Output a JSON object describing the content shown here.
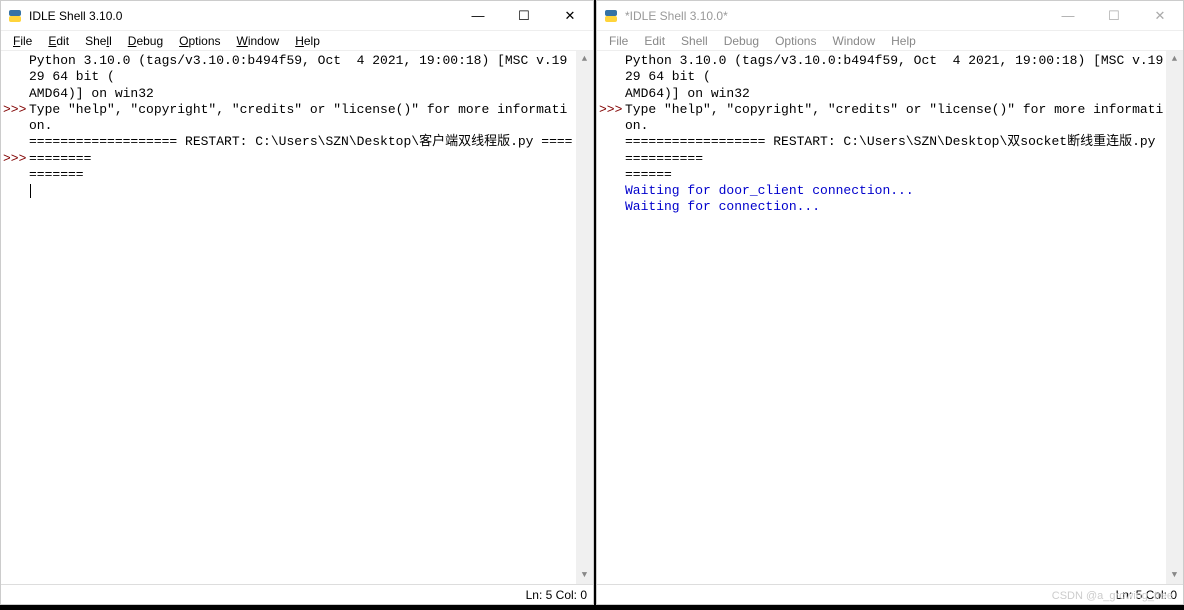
{
  "left": {
    "title": "IDLE Shell 3.10.0",
    "menus": [
      "File",
      "Edit",
      "Shell",
      "Debug",
      "Options",
      "Window",
      "Help"
    ],
    "python_banner_line1": "Python 3.10.0 (tags/v3.10.0:b494f59, Oct  4 2021, 19:00:18) [MSC v.1929 64 bit (",
    "python_banner_line2": "AMD64)] on win32",
    "python_banner_line3": "Type \"help\", \"copyright\", \"credits\" or \"license()\" for more information.",
    "prompt1": ">>>",
    "restart_line1": "=================== RESTART: C:\\Users\\SZN\\Desktop\\客户端双线程版.py ============",
    "restart_line2": "=======",
    "prompt2": ">>>",
    "status": "Ln: 5  Col: 0"
  },
  "right": {
    "title": "*IDLE Shell 3.10.0*",
    "menus": [
      "File",
      "Edit",
      "Shell",
      "Debug",
      "Options",
      "Window",
      "Help"
    ],
    "python_banner_line1": "Python 3.10.0 (tags/v3.10.0:b494f59, Oct  4 2021, 19:00:18) [MSC v.1929 64 bit (",
    "python_banner_line2": "AMD64)] on win32",
    "python_banner_line3": "Type \"help\", \"copyright\", \"credits\" or \"license()\" for more information.",
    "prompt1": ">>>",
    "restart_line1": "================== RESTART: C:\\Users\\SZN\\Desktop\\双socket断线重连版.py ==========",
    "restart_line2": "======",
    "out1": "Waiting for door_client connection...",
    "out2": "Waiting for connection...",
    "status": "Ln: 5  Col: 0"
  },
  "watermark": "CSDN @a_growing_tree",
  "controls": {
    "minimize": "—",
    "maximize": "☐",
    "close": "✕"
  },
  "scroll": {
    "up": "▲",
    "down": "▼"
  }
}
